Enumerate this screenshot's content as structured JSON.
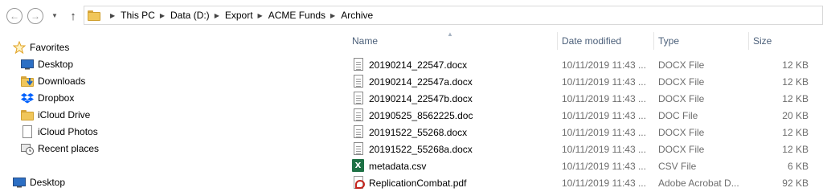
{
  "nav_buttons": {
    "back": "←",
    "forward": "→",
    "recent": "▼",
    "up": "↑"
  },
  "breadcrumb": [
    "This PC",
    "Data (D:)",
    "Export",
    "ACME Funds",
    "Archive"
  ],
  "sidebar": {
    "favorites_label": "Favorites",
    "items": [
      {
        "label": "Desktop",
        "icon": "desktop-icon"
      },
      {
        "label": "Downloads",
        "icon": "downloads-folder-icon"
      },
      {
        "label": "Dropbox",
        "icon": "dropbox-icon"
      },
      {
        "label": "iCloud Drive",
        "icon": "folder-icon"
      },
      {
        "label": "iCloud Photos",
        "icon": "document-icon"
      },
      {
        "label": "Recent places",
        "icon": "recent-places-icon"
      }
    ],
    "desktop_label": "Desktop"
  },
  "columns": {
    "name": "Name",
    "date": "Date modified",
    "type": "Type",
    "size": "Size"
  },
  "files": [
    {
      "name": "20190214_22547.docx",
      "date": "10/11/2019 11:43 ...",
      "type": "DOCX File",
      "size": "12 KB",
      "icon": "word-document-icon"
    },
    {
      "name": "20190214_22547a.docx",
      "date": "10/11/2019 11:43 ...",
      "type": "DOCX File",
      "size": "12 KB",
      "icon": "word-document-icon"
    },
    {
      "name": "20190214_22547b.docx",
      "date": "10/11/2019 11:43 ...",
      "type": "DOCX File",
      "size": "12 KB",
      "icon": "word-document-icon"
    },
    {
      "name": "20190525_8562225.doc",
      "date": "10/11/2019 11:43 ...",
      "type": "DOC File",
      "size": "20 KB",
      "icon": "word-document-icon"
    },
    {
      "name": "20191522_55268.docx",
      "date": "10/11/2019 11:43 ...",
      "type": "DOCX File",
      "size": "12 KB",
      "icon": "word-document-icon"
    },
    {
      "name": "20191522_55268a.docx",
      "date": "10/11/2019 11:43 ...",
      "type": "DOCX File",
      "size": "12 KB",
      "icon": "word-document-icon"
    },
    {
      "name": "metadata.csv",
      "date": "10/11/2019 11:43 ...",
      "type": "CSV File",
      "size": "6 KB",
      "icon": "excel-csv-icon"
    },
    {
      "name": "ReplicationCombat.pdf",
      "date": "10/11/2019 11:43 ...",
      "type": "Adobe Acrobat D...",
      "size": "92 KB",
      "icon": "pdf-icon"
    }
  ],
  "colors": {
    "header_text": "#4c607a",
    "detail_text": "#6d6d6d",
    "folder": "#f0c65a",
    "excel": "#1e7145",
    "pdf": "#c4241c",
    "dropbox": "#0061fe"
  }
}
